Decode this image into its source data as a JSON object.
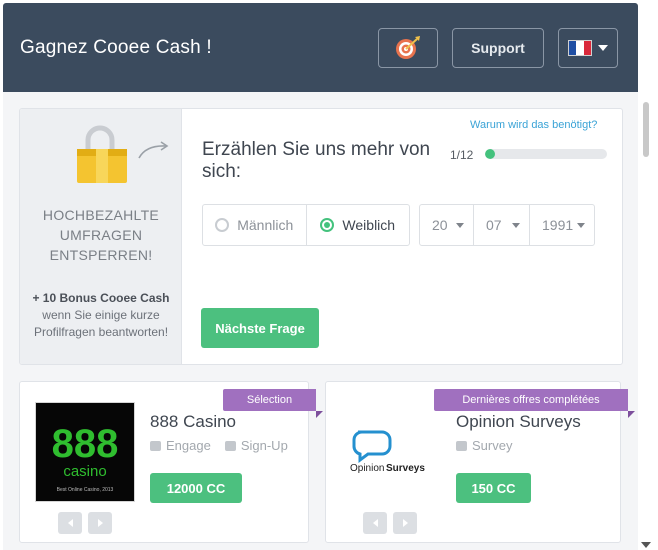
{
  "header": {
    "title": "Gagnez Cooee Cash !",
    "support_label": "Support",
    "target_icon": "target-icon",
    "language": "fr"
  },
  "profile": {
    "unlock_text": "HOCHBEZAHLTE UMFRAGEN ENTSPERREN!",
    "bonus_bold": "+ 10 Bonus Cooee Cash",
    "bonus_rest": " wenn Sie einige kurze Profilfragen beantworten!",
    "why_link": "Warum wird das benötigt?",
    "question": "Erzählen Sie uns mehr von sich:",
    "progress_label": "1/12",
    "progress_fraction": 0.0833,
    "gender": {
      "male_label": "Männlich",
      "female_label": "Weiblich",
      "selected": "female"
    },
    "birthdate": {
      "day": "20",
      "month": "07",
      "year": "1991"
    },
    "next_label": "Nächste Frage"
  },
  "offers": [
    {
      "ribbon": "Sélection",
      "name": "888 Casino",
      "tag1": "Engage",
      "tag2": "Sign-Up",
      "reward": "12000 CC",
      "logo_text_main": "888",
      "logo_text_sub": "casino",
      "logo_caption": "Best Online Casino, 2013"
    },
    {
      "ribbon": "Dernières offres complétées",
      "name": "Opinion Surveys",
      "tag1": "Survey",
      "reward": "150 CC",
      "logo_text_a": "Opinion",
      "logo_text_b": "Surveys"
    }
  ],
  "colors": {
    "header_bg": "#3b4b5e",
    "accent_green": "#4cc07f",
    "ribbon_purple": "#a070bf",
    "link_blue": "#3aa3d6"
  }
}
